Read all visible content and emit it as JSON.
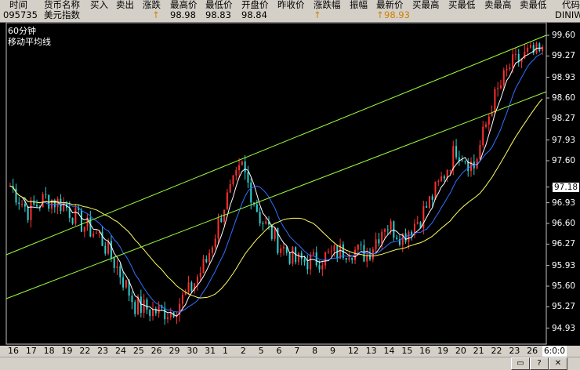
{
  "header": {
    "labels": [
      "时间",
      "货币名称",
      "买入",
      "卖出",
      "涨跌",
      "最高价",
      "最低价",
      "开盘价",
      "昨收价",
      "涨跌幅",
      "振幅",
      "最新价",
      "买最高",
      "买最低",
      "卖最高",
      "卖最低",
      "代码"
    ],
    "row": {
      "time": "095735",
      "name": "美元指数",
      "up_arrow_1": "↑",
      "high": "98.98",
      "low": "98.83",
      "open": "98.84",
      "up_arrow_2": "↑",
      "latest_arrow": "↑",
      "latest": "98.93",
      "code": "DINIW"
    }
  },
  "chart": {
    "period": "60分钟",
    "indicator": "移动平均线",
    "y_ticks": [
      "99.60",
      "99.27",
      "98.93",
      "98.60",
      "98.27",
      "97.93",
      "97.60",
      "97.18",
      "96.93",
      "96.60",
      "96.27",
      "95.93",
      "95.60",
      "95.27",
      "94.93"
    ],
    "current_price": "97.18",
    "x_ticks": [
      "16",
      "17",
      "18",
      "19",
      "22",
      "23",
      "24",
      "25",
      "26",
      "29",
      "30",
      "31",
      "1",
      "2",
      "5",
      "6",
      "7",
      "8",
      "9",
      "12",
      "13",
      "14",
      "15",
      "16",
      "19",
      "20",
      "21",
      "22",
      "23",
      "26"
    ],
    "time_label": "6:0:0"
  },
  "colors": {
    "background": "#000000",
    "channel": "#9cff3c",
    "up": "#ff3030",
    "down": "#30d0d0",
    "ma_short": "#ffffff",
    "ma_mid": "#3070ff",
    "ma_long": "#ffff60"
  },
  "chart_data": {
    "type": "line",
    "title": "",
    "x": [
      "16",
      "17",
      "18",
      "19",
      "22",
      "23",
      "24",
      "25",
      "26",
      "29",
      "30",
      "31",
      "1",
      "2",
      "5",
      "6",
      "7",
      "8",
      "9",
      "12",
      "13",
      "14",
      "15",
      "16",
      "19",
      "20",
      "21",
      "22",
      "23",
      "26"
    ],
    "series": [
      {
        "values": [
          97.2,
          96.8,
          97.0,
          96.9,
          96.6,
          96.4,
          95.9,
          95.3,
          95.2,
          95.2,
          95.5,
          96.0,
          96.9,
          97.5,
          96.7,
          96.3,
          96.0,
          96.0,
          96.1,
          96.2,
          96.1,
          96.6,
          96.4,
          96.7,
          97.2,
          97.8,
          97.5,
          98.5,
          99.1,
          99.3
        ]
      }
    ],
    "ylim": [
      94.8,
      99.7
    ]
  },
  "toolbar": {
    "buttons": [
      "help-icon",
      "window-icon",
      "close-icon"
    ]
  }
}
